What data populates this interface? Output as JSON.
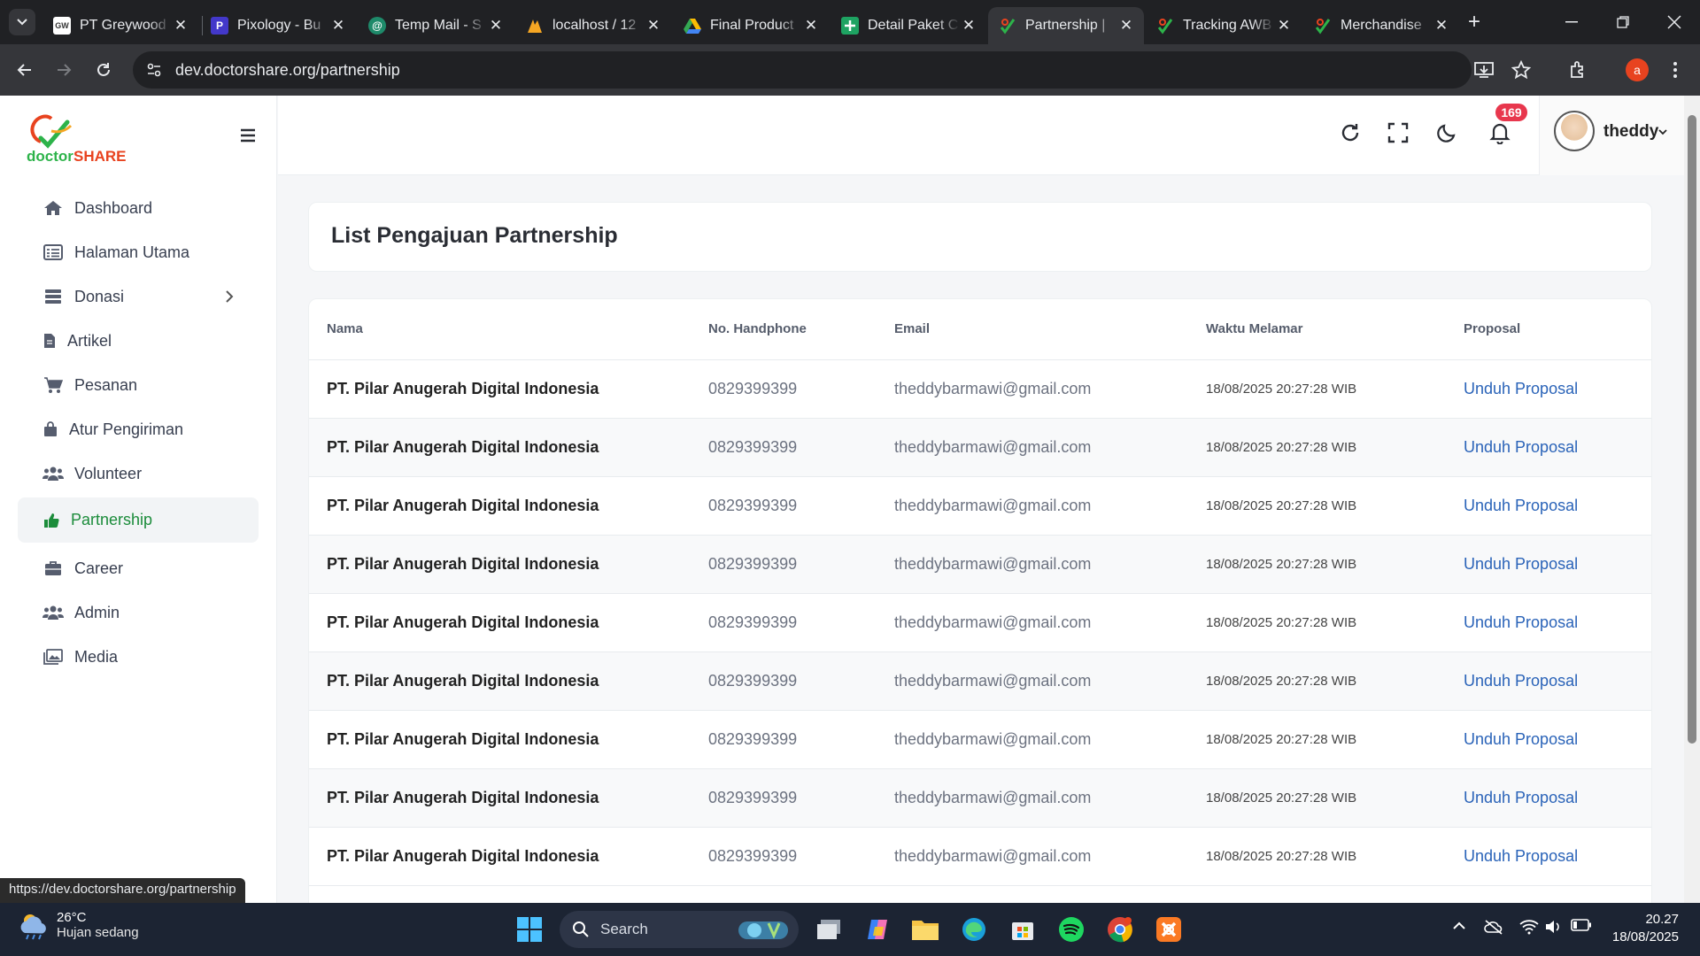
{
  "browser": {
    "tabs": [
      {
        "title": "PT Greywood",
        "favicon": "greywood-icon",
        "active": false
      },
      {
        "title": "Pixology - Bu",
        "favicon": "pixology-icon",
        "active": false
      },
      {
        "title": "Temp Mail - S",
        "favicon": "tempmail-icon",
        "active": false
      },
      {
        "title": "localhost / 12",
        "favicon": "phpmyadmin-icon",
        "active": false
      },
      {
        "title": "Final Product",
        "favicon": "google-drive-icon",
        "active": false
      },
      {
        "title": "Detail Paket C",
        "favicon": "google-sheets-icon",
        "active": false
      },
      {
        "title": "Partnership | ",
        "favicon": "doctorshare-icon",
        "active": true
      },
      {
        "title": "Tracking AWB",
        "favicon": "doctorshare-icon",
        "active": false
      },
      {
        "title": "Merchandise",
        "favicon": "doctorshare-icon",
        "active": false
      }
    ],
    "url": "dev.doctorshare.org/partnership",
    "profile_initial": "a",
    "status_url": "https://dev.doctorshare.org/partnership"
  },
  "app": {
    "logo_text_a": "doctor",
    "logo_text_b": "SHARE",
    "sidebar": [
      {
        "label": "Dashboard",
        "icon": "home-icon"
      },
      {
        "label": "Halaman Utama",
        "icon": "list-icon"
      },
      {
        "label": "Donasi",
        "icon": "stack-icon",
        "has_submenu": true
      },
      {
        "label": "Artikel",
        "icon": "document-icon"
      },
      {
        "label": "Pesanan",
        "icon": "cart-icon"
      },
      {
        "label": "Atur Pengiriman",
        "icon": "bag-icon"
      },
      {
        "label": "Volunteer",
        "icon": "users-icon"
      },
      {
        "label": "Partnership",
        "icon": "thumbs-up-icon",
        "active": true
      },
      {
        "label": "Career",
        "icon": "briefcase-icon"
      },
      {
        "label": "Admin",
        "icon": "users-icon"
      },
      {
        "label": "Media",
        "icon": "images-icon"
      }
    ],
    "header": {
      "notification_count": "169",
      "username": "theddy"
    },
    "page_title": "List Pengajuan Partnership",
    "table": {
      "columns": [
        "Nama",
        "No. Handphone",
        "Email",
        "Waktu Melamar",
        "Proposal"
      ],
      "rows": [
        {
          "nama": "PT. Pilar Anugerah Digital Indonesia",
          "phone": "0829399399",
          "email": "theddybarmawi@gmail.com",
          "waktu": "18/08/2025 20:27:28 WIB",
          "proposal": "Unduh Proposal"
        },
        {
          "nama": "PT. Pilar Anugerah Digital Indonesia",
          "phone": "0829399399",
          "email": "theddybarmawi@gmail.com",
          "waktu": "18/08/2025 20:27:28 WIB",
          "proposal": "Unduh Proposal"
        },
        {
          "nama": "PT. Pilar Anugerah Digital Indonesia",
          "phone": "0829399399",
          "email": "theddybarmawi@gmail.com",
          "waktu": "18/08/2025 20:27:28 WIB",
          "proposal": "Unduh Proposal"
        },
        {
          "nama": "PT. Pilar Anugerah Digital Indonesia",
          "phone": "0829399399",
          "email": "theddybarmawi@gmail.com",
          "waktu": "18/08/2025 20:27:28 WIB",
          "proposal": "Unduh Proposal"
        },
        {
          "nama": "PT. Pilar Anugerah Digital Indonesia",
          "phone": "0829399399",
          "email": "theddybarmawi@gmail.com",
          "waktu": "18/08/2025 20:27:28 WIB",
          "proposal": "Unduh Proposal"
        },
        {
          "nama": "PT. Pilar Anugerah Digital Indonesia",
          "phone": "0829399399",
          "email": "theddybarmawi@gmail.com",
          "waktu": "18/08/2025 20:27:28 WIB",
          "proposal": "Unduh Proposal"
        },
        {
          "nama": "PT. Pilar Anugerah Digital Indonesia",
          "phone": "0829399399",
          "email": "theddybarmawi@gmail.com",
          "waktu": "18/08/2025 20:27:28 WIB",
          "proposal": "Unduh Proposal"
        },
        {
          "nama": "PT. Pilar Anugerah Digital Indonesia",
          "phone": "0829399399",
          "email": "theddybarmawi@gmail.com",
          "waktu": "18/08/2025 20:27:28 WIB",
          "proposal": "Unduh Proposal"
        },
        {
          "nama": "PT. Pilar Anugerah Digital Indonesia",
          "phone": "0829399399",
          "email": "theddybarmawi@gmail.com",
          "waktu": "18/08/2025 20:27:28 WIB",
          "proposal": "Unduh Proposal"
        }
      ]
    }
  },
  "taskbar": {
    "weather_temp": "26°C",
    "weather_desc": "Hujan sedang",
    "search_label": "Search",
    "time": "20.27",
    "date": "18/08/2025"
  },
  "colors": {
    "accent_green": "#1c8c3b",
    "link_blue": "#2a63b8",
    "badge_red": "#e8374d",
    "logo_orange": "#e8431f"
  }
}
